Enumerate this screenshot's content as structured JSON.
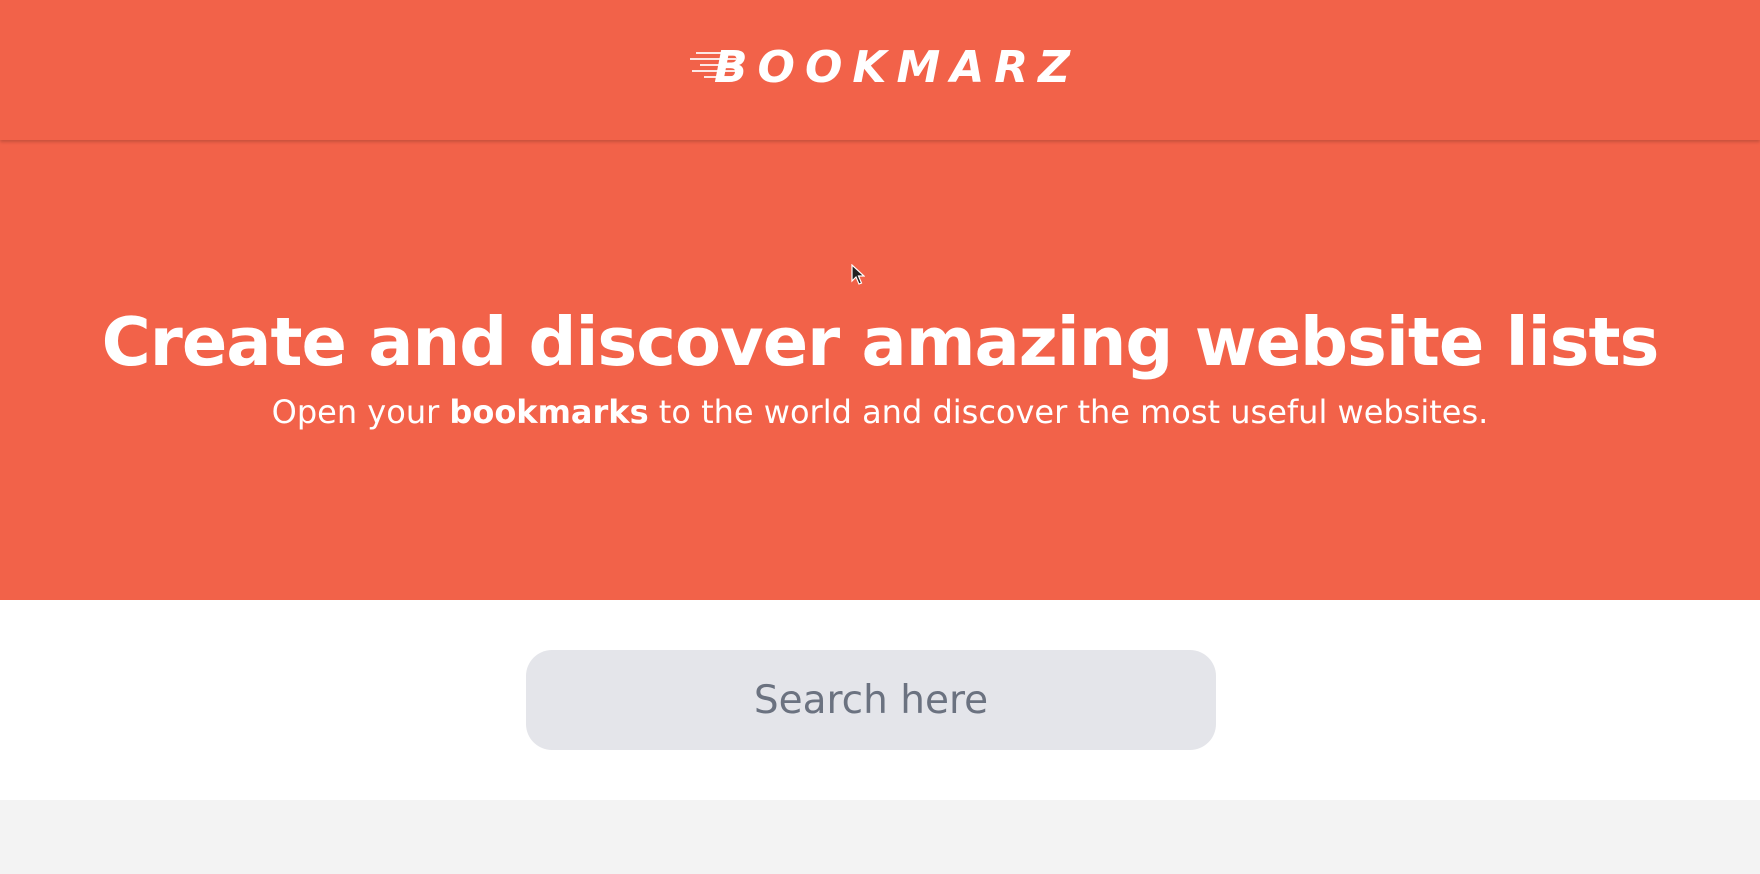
{
  "header": {
    "logo_text": "BOOKMARZ",
    "logo_icon": "speed-lines"
  },
  "hero": {
    "title": "Create and discover amazing website lists",
    "subtitle_prefix": "Open your ",
    "subtitle_bold": "bookmarks",
    "subtitle_suffix": " to the world and discover the most useful websites."
  },
  "search": {
    "placeholder": "Search here",
    "value": ""
  },
  "colors": {
    "brand": "#f26249",
    "search_bg": "#e4e5ea",
    "footer_bg": "#f3f3f3"
  }
}
